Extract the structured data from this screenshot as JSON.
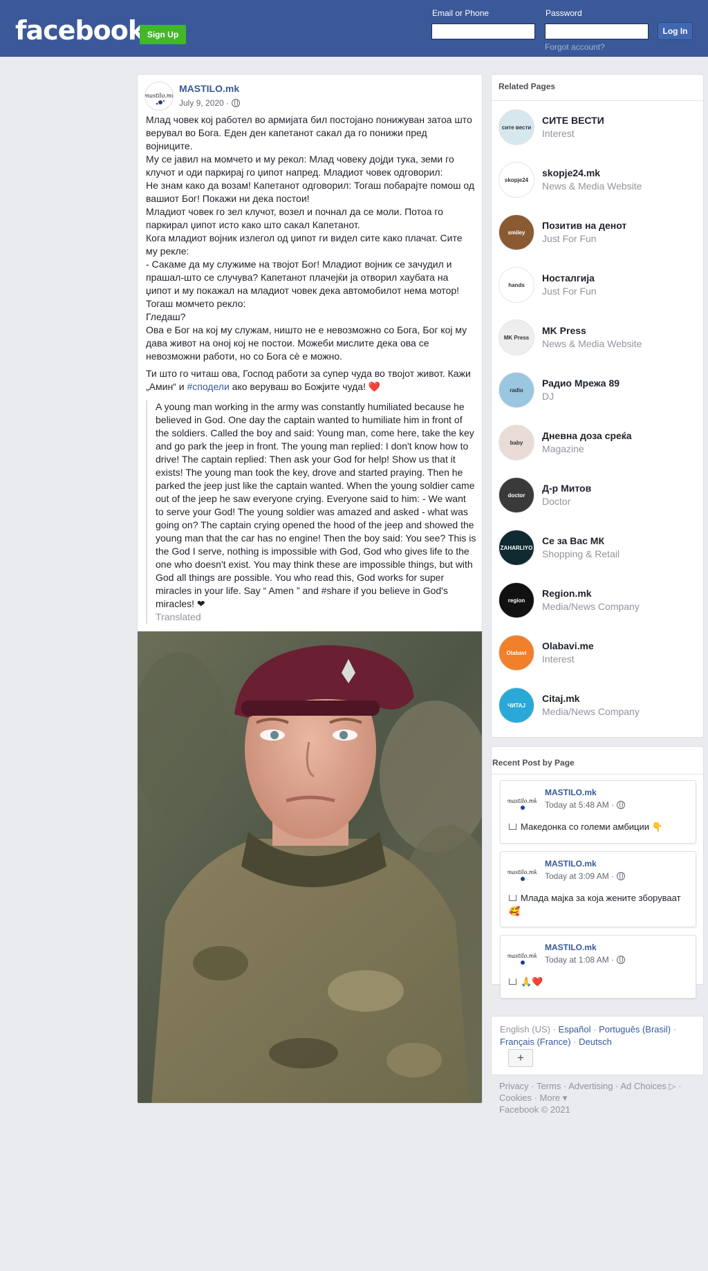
{
  "header": {
    "logo": "facebook",
    "signup_label": "Sign Up",
    "email_label": "Email or Phone",
    "password_label": "Password",
    "login_label": "Log In",
    "forgot_label": "Forgot account?"
  },
  "post": {
    "author": "MASTILO.mk",
    "date": "July 9, 2020 ·",
    "avatar_text": "mastilo.mk",
    "paragraph1": [
      "Млад човек кој работел во армијата бил постојано понижуван затоа што верувал во Бога. Еден ден капетанот сакал да го понижи пред војниците.",
      "Му се јавил на момчето и му рекол: Млад човеку дојди тука, земи го клучот и оди паркирај го џипот напред. Младиот човек одговорил:",
      "Не знам како да возам! Капетанот одговорил: Тогаш побарајте помош од вашиот Бог! Покажи ни дека постои!",
      "Младиот човек го зел клучот, возел и почнал да се моли. Потоа го паркирал џипот исто како што сакал Капетанот.",
      "Кога младиот војник излегол од џипот ги видел сите како плачат. Сите му рекле:",
      "- Сакаме да му служиме на твојот Бог! Младиот војник се зачудил и прашал-што се случува? Капетанот плачејќи ја отворил хаубата на џипот и му покажал на младиот човек дека автомобилот нема мотор!",
      "Тогаш момчето рекло:",
      "Гледаш?",
      "Ова е Бог на кој му служам, ништо не е невозможно со Бога, Бог кој му дава живот на оној кој не постои. Можеби мислите дека ова се невозможни работи, но со Бога сè е можно."
    ],
    "paragraph2_before": "Ти што го читаш ова, Господ работи за супер чуда во твојот живот. Кажи „Амин“ и ",
    "paragraph2_hashtag": "#сподели",
    "paragraph2_after": " ако веруваш во Божјите чуда! ",
    "paragraph2_heart": "❤️",
    "translation": "A young man working in the army was constantly humiliated because he believed in God. One day the captain wanted to humiliate him in front of the soldiers. Called the boy and said: Young man, come here, take the key and go park the jeep in front. The young man replied: I don't know how to drive! The captain replied: Then ask your God for help! Show us that it exists! The young man took the key, drove and started praying. Then he parked the jeep just like the captain wanted. When the young soldier came out of the jeep he saw everyone crying. Everyone said to him: - We want to serve your God! The young soldier was amazed and asked - what was going on? The captain crying opened the hood of the jeep and showed the young man that the car has no engine! Then the boy said: You see? This is the God I serve, nothing is impossible with God, God who gives life to the one who doesn't exist. You may think these are impossible things, but with God all things are possible. You who read this, God works for super miracles in your life. Say “ Amen ” and #share if you believe in God's miracles! ❤",
    "translated_label": "Translated"
  },
  "related": {
    "title": "Related Pages",
    "items": [
      {
        "name": "СИТЕ ВЕСТИ",
        "category": "Interest",
        "icon": "сите вести",
        "color": "#d6e7ee"
      },
      {
        "name": "skopje24.mk",
        "category": "News & Media Website",
        "icon": "skopje24",
        "color": "#ffffff"
      },
      {
        "name": "Позитив на денот",
        "category": "Just For Fun",
        "icon": "smiley",
        "color": "#8a5a33"
      },
      {
        "name": "Носталгија",
        "category": "Just For Fun",
        "icon": "hands",
        "color": "#ffffff"
      },
      {
        "name": "MK Press",
        "category": "News & Media Website",
        "icon": "MK Press",
        "color": "#eeeeee"
      },
      {
        "name": "Радио Мрежа 89",
        "category": "DJ",
        "icon": "radio",
        "color": "#9ac6e0"
      },
      {
        "name": "Дневна доза среќа",
        "category": "Magazine",
        "icon": "baby",
        "color": "#e9dcd6"
      },
      {
        "name": "Д-р Митов",
        "category": "Doctor",
        "icon": "doctor",
        "color": "#3a3a3a"
      },
      {
        "name": "Се за Вас МК",
        "category": "Shopping & Retail",
        "icon": "ZAHARLIYO",
        "color": "#0f2a30"
      },
      {
        "name": "Region.mk",
        "category": "Media/News Company",
        "icon": "region",
        "color": "#111111"
      },
      {
        "name": "Olabavi.me",
        "category": "Interest",
        "icon": "Olabavi",
        "color": "#f0802a"
      },
      {
        "name": "Citaj.mk",
        "category": "Media/News Company",
        "icon": "ЧИТАЈ",
        "color": "#2aa9d8"
      }
    ]
  },
  "recent": {
    "title": "Recent Post by Page",
    "posts": [
      {
        "author": "MASTILO.mk",
        "time": "Today at 5:48 AM ·",
        "text": "Македонка со големи амбиции 👇"
      },
      {
        "author": "MASTILO.mk",
        "time": "Today at 3:09 AM ·",
        "text": "Млада мајка за која жените зборуваат 🥰"
      },
      {
        "author": "MASTILO.mk",
        "time": "Today at 1:08 AM ·",
        "text": "🙏❤️"
      }
    ]
  },
  "languages": {
    "current": "English (US)",
    "others": [
      "Español",
      "Português (Brasil)",
      "Français (France)",
      "Deutsch"
    ],
    "more_label": "+"
  },
  "footer": {
    "links": [
      "Privacy",
      "Terms",
      "Advertising",
      "Ad Choices ▷",
      "Cookies",
      "More ▾"
    ],
    "copyright": "Facebook © 2021"
  },
  "colors": {
    "brand": "#3b5998",
    "link": "#365899",
    "signup": "#42b72a"
  }
}
